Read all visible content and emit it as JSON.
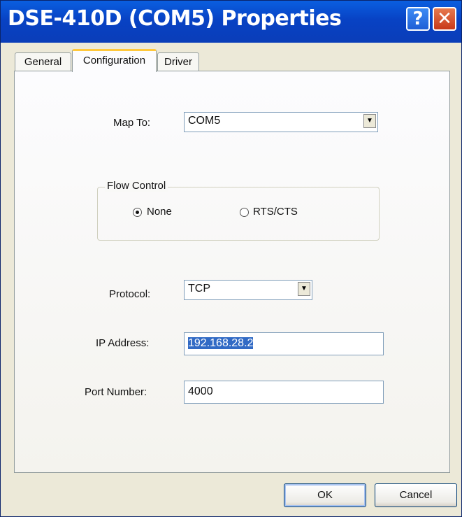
{
  "window": {
    "title": "DSE-410D (COM5) Properties"
  },
  "titlebar": {
    "help_glyph": "?",
    "close_glyph": "✕"
  },
  "tabs": [
    {
      "label": "General"
    },
    {
      "label": "Configuration"
    },
    {
      "label": "Driver"
    }
  ],
  "map_to": {
    "label": "Map To:",
    "value": "COM5"
  },
  "flow_control": {
    "title": "Flow Control",
    "options": [
      {
        "label": "None",
        "selected": true
      },
      {
        "label": "RTS/CTS",
        "selected": false
      }
    ]
  },
  "protocol": {
    "label": "Protocol:",
    "value": "TCP"
  },
  "ip_address": {
    "label": "IP Address:",
    "value": "192.168.28.2"
  },
  "port_number": {
    "label": "Port Number:",
    "value": "4000"
  },
  "buttons": {
    "ok": "OK",
    "cancel": "Cancel"
  },
  "icons": {
    "dropdown": "chevron-down-icon",
    "help": "help-icon",
    "close": "close-icon"
  },
  "colors": {
    "titlebar": "#0a46c8",
    "selection": "#316ac5",
    "active_tab_accent": "#ffc83c"
  }
}
